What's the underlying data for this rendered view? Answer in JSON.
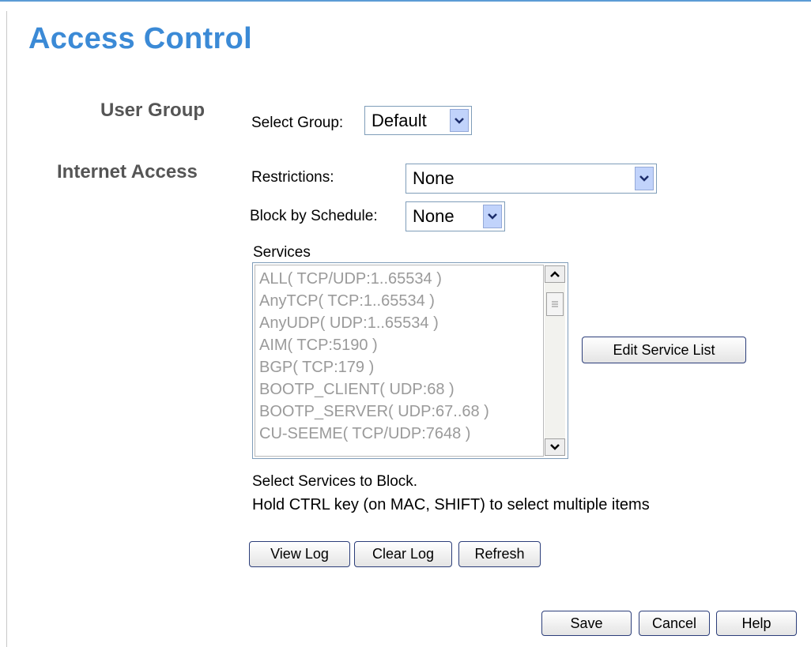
{
  "page": {
    "title": "Access Control"
  },
  "user_group": {
    "section_label": "User Group",
    "select_label": "Select Group:",
    "select_value": "Default"
  },
  "internet_access": {
    "section_label": "Internet Access",
    "restrictions_label": "Restrictions:",
    "restrictions_value": "None",
    "schedule_label": "Block by Schedule:",
    "schedule_value": "None"
  },
  "services": {
    "label": "Services",
    "items": [
      "ALL( TCP/UDP:1..65534 )",
      "AnyTCP( TCP:1..65534 )",
      "AnyUDP( UDP:1..65534 )",
      "AIM( TCP:5190 )",
      "BGP( TCP:179 )",
      "BOOTP_CLIENT( UDP:68 )",
      "BOOTP_SERVER( UDP:67..68 )",
      "CU-SEEME( TCP/UDP:7648 )"
    ],
    "edit_button": "Edit Service List",
    "hint_line1": "Select Services to Block.",
    "hint_line2": "Hold CTRL key (on MAC, SHIFT) to select multiple items"
  },
  "log_buttons": {
    "view": "View Log",
    "clear": "Clear Log",
    "refresh": "Refresh"
  },
  "footer_buttons": {
    "save": "Save",
    "cancel": "Cancel",
    "help": "Help"
  }
}
